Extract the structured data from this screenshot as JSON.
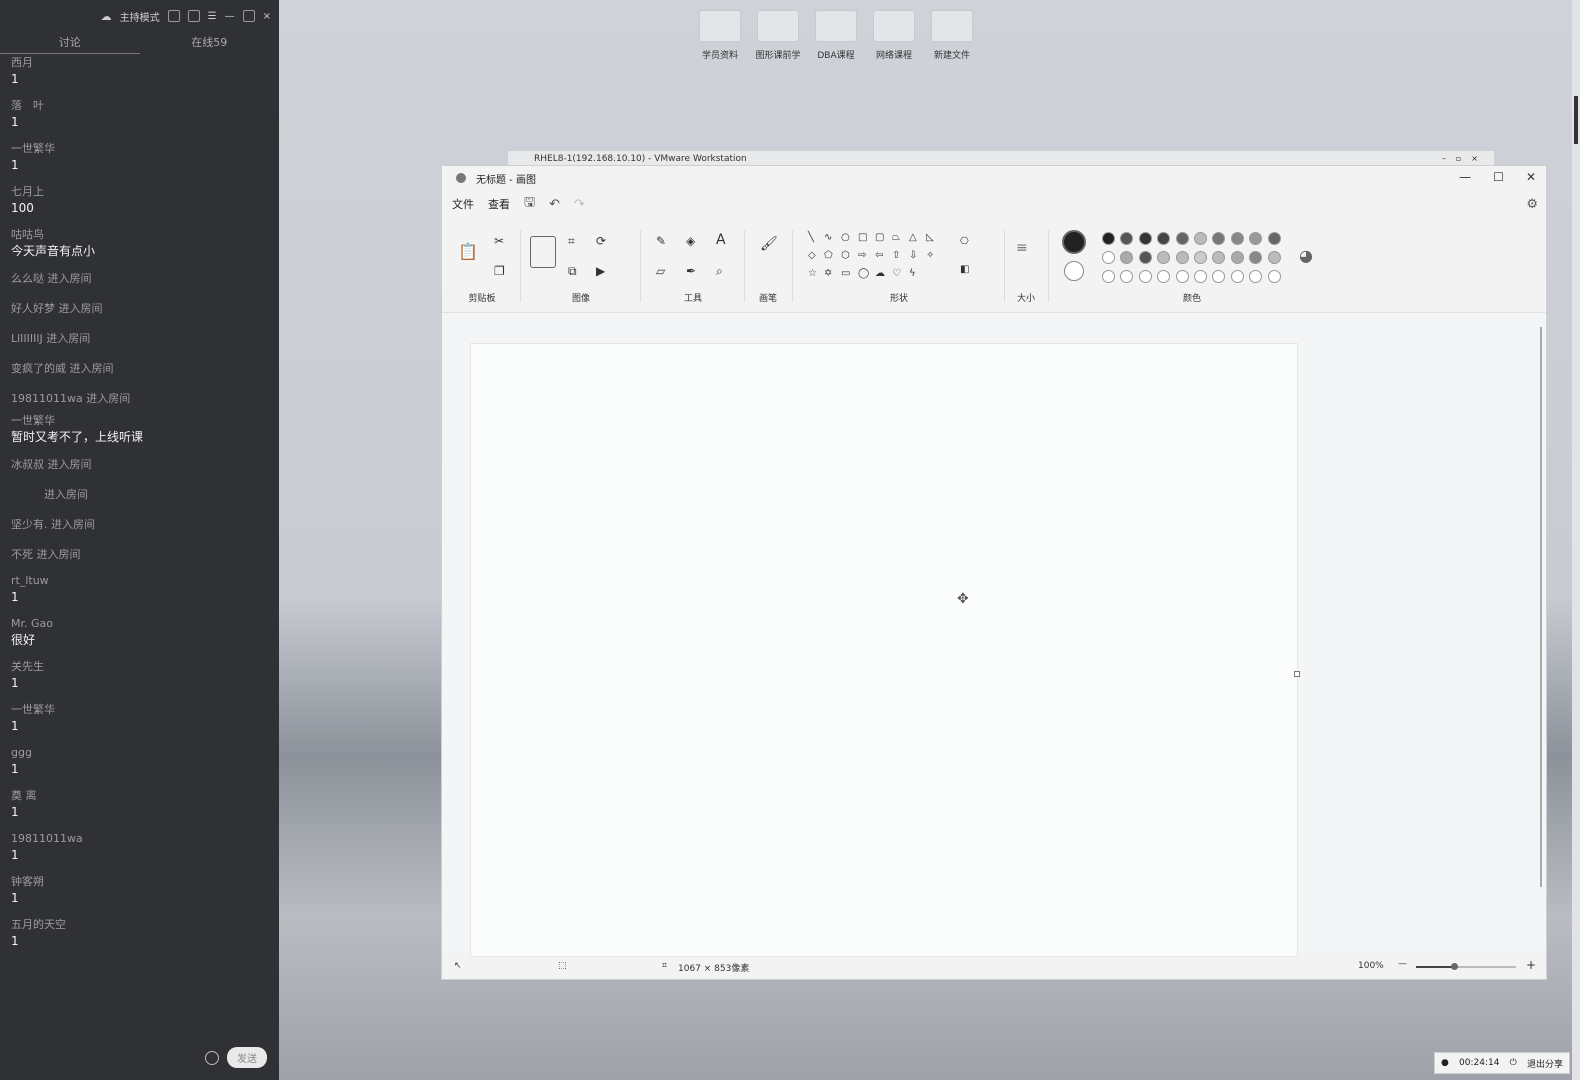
{
  "chat": {
    "header": {
      "mode": "主持模式"
    },
    "tabs": [
      "讨论",
      "在线59"
    ],
    "messages": [
      {
        "name": "西月",
        "text": "1"
      },
      {
        "name": "落　叶",
        "text": "1"
      },
      {
        "name": "一世繁华",
        "text": "1"
      },
      {
        "name": "七月上",
        "text": "100"
      },
      {
        "name": "咕咕鸟",
        "text": "今天声音有点小"
      }
    ],
    "system_events": [
      "么么哒 进入房间",
      "好人好梦 进入房间",
      "LlIIIIIlJ 进入房间",
      "变疯了的威 进入房间",
      "19811011wa 进入房间"
    ],
    "messages2": [
      {
        "name": "一世繁华",
        "text": "暂时又考不了，上线听课"
      }
    ],
    "system_events2": [
      "冰叔叔 进入房间",
      "　　　进入房间",
      "坚少有. 进入房间",
      "不死 进入房间"
    ],
    "messages3": [
      {
        "name": "rt_ltuw",
        "text": "1"
      },
      {
        "name": "Mr. Gao",
        "text": "很好"
      },
      {
        "name": "关先生",
        "text": "1"
      },
      {
        "name": "一世繁华",
        "text": "1"
      },
      {
        "name": "ggg",
        "text": "1"
      },
      {
        "name": "奠 离",
        "text": "1"
      },
      {
        "name": "19811011wa",
        "text": "1"
      },
      {
        "name": "钟客朔",
        "text": "1"
      },
      {
        "name": "五月的天空",
        "text": "1"
      }
    ],
    "send_label": "发送"
  },
  "desktop": {
    "icons": [
      "学员资料",
      "图形课前学",
      "DBA课程",
      "网络课程",
      "新建文件"
    ]
  },
  "vmware": {
    "title": "RHEL8-1(192.168.10.10) - VMware Workstation"
  },
  "paint": {
    "title": "无标题 - 画图",
    "menu": [
      "文件",
      "查看"
    ],
    "groups": {
      "clipboard": "剪贴板",
      "image": "图像",
      "tools": "工具",
      "brushes": "画笔",
      "shapes": "形状",
      "size": "大小",
      "colors": "颜色"
    },
    "status": {
      "dimensions": "1067 × 853像素",
      "zoom": "100%",
      "zoom_level": 0.38
    },
    "palette": {
      "row1": [
        "#222222",
        "#555555",
        "#333333",
        "#444444",
        "#666666",
        "#bbbbbb",
        "#777777",
        "#888888",
        "#999999",
        "#666666"
      ],
      "row2": [
        "#ffffff",
        "#aaaaaa",
        "#555555",
        "#bbbbbb",
        "#bbbbbb",
        "#cccccc",
        "#bbbbbb",
        "#aaaaaa",
        "#888888",
        "#bbbbbb"
      ]
    },
    "primary_color": "#222222",
    "secondary_color": "#ffffff"
  },
  "tray": {
    "timer": "00:24:14",
    "exit_label": "退出分享"
  }
}
